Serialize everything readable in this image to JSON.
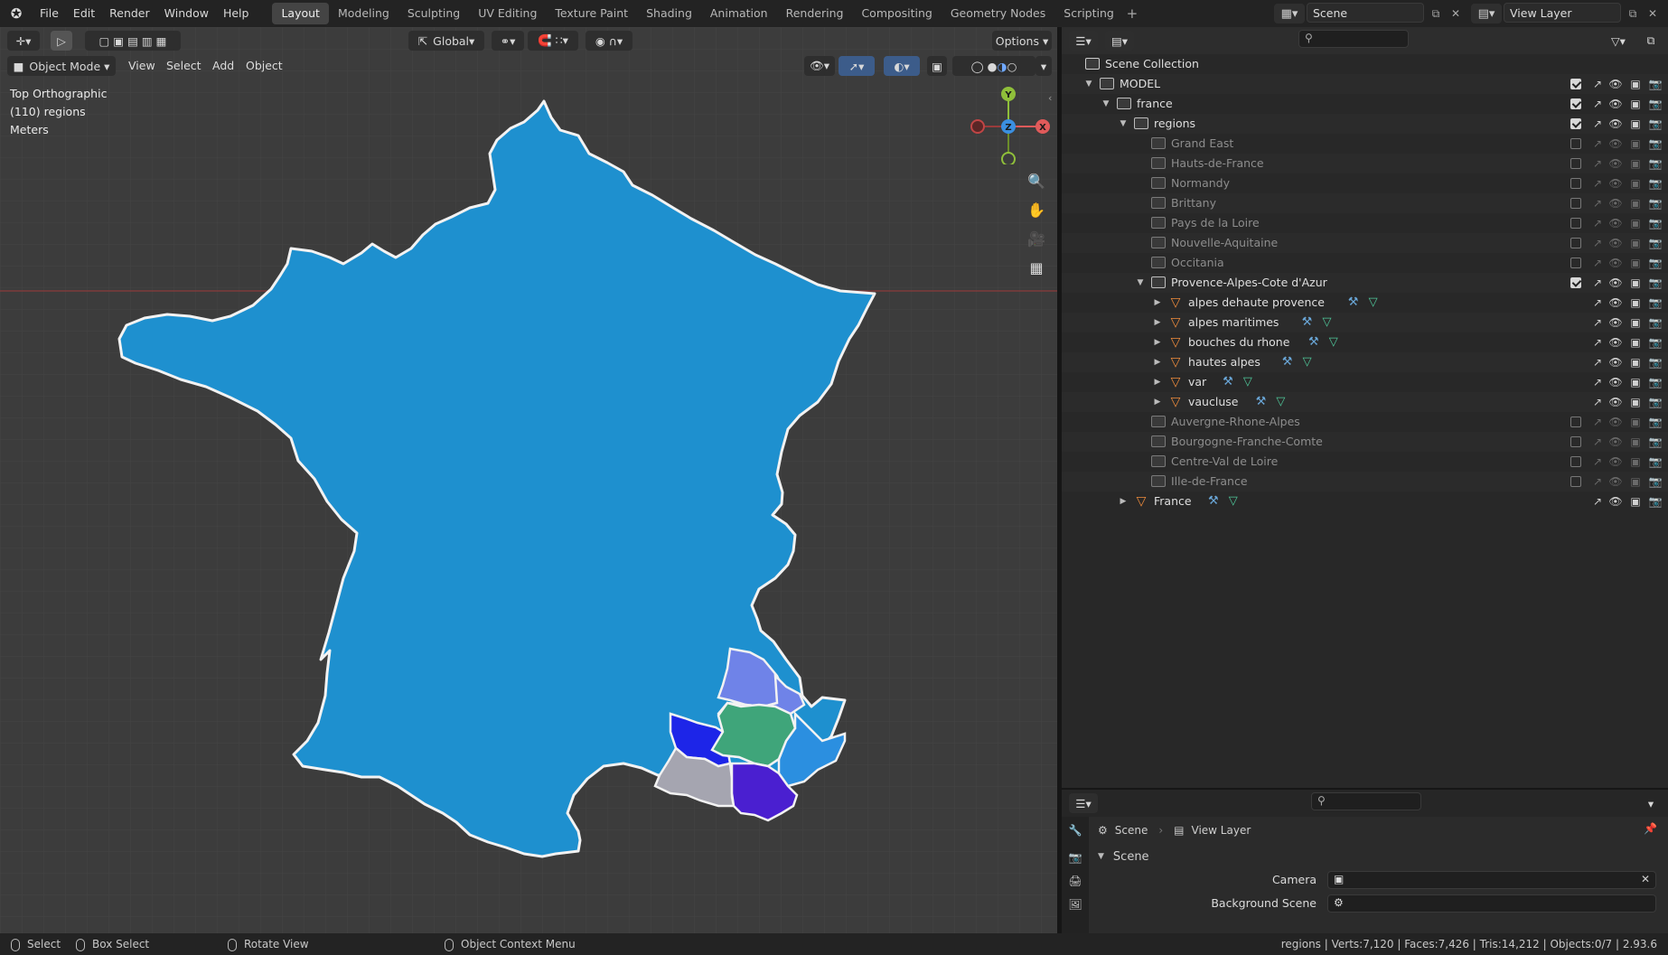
{
  "topbar": {
    "menus": [
      "File",
      "Edit",
      "Render",
      "Window",
      "Help"
    ],
    "workspaces": [
      "Layout",
      "Modeling",
      "Sculpting",
      "UV Editing",
      "Texture Paint",
      "Shading",
      "Animation",
      "Rendering",
      "Compositing",
      "Geometry Nodes",
      "Scripting"
    ],
    "active_workspace": "Layout",
    "scene_name": "Scene",
    "view_layer_name": "View Layer"
  },
  "viewport": {
    "transform_orientation": "Global",
    "options_label": "Options",
    "mode": "Object Mode",
    "menus": [
      "View",
      "Select",
      "Add",
      "Object"
    ],
    "info_view": "Top Orthographic",
    "info_collection": "(110) regions",
    "info_units": "Meters",
    "gizmo_axes": [
      "Y",
      "Z",
      "X"
    ],
    "colors": {
      "background": "#3c3c3c",
      "france_fill": "#1e90cf",
      "alpes_haute_provence": "#6f83e8",
      "alpes_maritimes": "#2b8fe0",
      "bouches_du_rhone": "#a5a5b0",
      "hautes_alpes": "#6f83e8",
      "var": "#4a1fd0",
      "vaucluse": "#1d25e8",
      "green_region": "#3fa57a"
    }
  },
  "outliner": {
    "root": "Scene Collection",
    "rows": [
      {
        "label": "MODEL",
        "type": "collection",
        "depth": 0,
        "expanded": true,
        "checked": true,
        "dim": false
      },
      {
        "label": "france",
        "type": "collection",
        "depth": 1,
        "expanded": true,
        "checked": true,
        "dim": false
      },
      {
        "label": "regions",
        "type": "collection",
        "depth": 2,
        "expanded": true,
        "checked": true,
        "dim": false
      },
      {
        "label": "Grand East",
        "type": "collection",
        "depth": 3,
        "checked": false,
        "dim": true
      },
      {
        "label": "Hauts-de-France",
        "type": "collection",
        "depth": 3,
        "checked": false,
        "dim": true
      },
      {
        "label": "Normandy",
        "type": "collection",
        "depth": 3,
        "checked": false,
        "dim": true
      },
      {
        "label": "Brittany",
        "type": "collection",
        "depth": 3,
        "checked": false,
        "dim": true
      },
      {
        "label": "Pays de la Loire",
        "type": "collection",
        "depth": 3,
        "checked": false,
        "dim": true
      },
      {
        "label": "Nouvelle-Aquitaine",
        "type": "collection",
        "depth": 3,
        "checked": false,
        "dim": true
      },
      {
        "label": "Occitania",
        "type": "collection",
        "depth": 3,
        "checked": false,
        "dim": true
      },
      {
        "label": "Provence-Alpes-Cote d'Azur",
        "type": "collection",
        "depth": 3,
        "expanded": true,
        "checked": true,
        "dim": false
      },
      {
        "label": "alpes dehaute provence",
        "type": "mesh",
        "depth": 4,
        "dim": false
      },
      {
        "label": "alpes maritimes",
        "type": "mesh",
        "depth": 4,
        "dim": false
      },
      {
        "label": "bouches du rhone",
        "type": "mesh",
        "depth": 4,
        "dim": false
      },
      {
        "label": "hautes alpes",
        "type": "mesh",
        "depth": 4,
        "dim": false
      },
      {
        "label": "var",
        "type": "mesh",
        "depth": 4,
        "dim": false
      },
      {
        "label": "vaucluse",
        "type": "mesh",
        "depth": 4,
        "dim": false
      },
      {
        "label": "Auvergne-Rhone-Alpes",
        "type": "collection",
        "depth": 3,
        "checked": false,
        "dim": true
      },
      {
        "label": "Bourgogne-Franche-Comte",
        "type": "collection",
        "depth": 3,
        "checked": false,
        "dim": true
      },
      {
        "label": "Centre-Val de Loire",
        "type": "collection",
        "depth": 3,
        "checked": false,
        "dim": true
      },
      {
        "label": "Ille-de-France",
        "type": "collection",
        "depth": 3,
        "checked": false,
        "dim": true
      },
      {
        "label": "France",
        "type": "mesh",
        "depth": 2,
        "dim": false
      }
    ]
  },
  "properties": {
    "breadcrumb_scene": "Scene",
    "breadcrumb_view_layer": "View Layer",
    "panel_title": "Scene",
    "camera_label": "Camera",
    "background_scene_label": "Background Scene"
  },
  "statusbar": {
    "select": "Select",
    "box_select": "Box Select",
    "rotate_view": "Rotate View",
    "context_menu": "Object Context Menu",
    "stats": "regions | Verts:7,120 | Faces:7,426 | Tris:14,212 | Objects:0/7 | 2.93.6"
  }
}
